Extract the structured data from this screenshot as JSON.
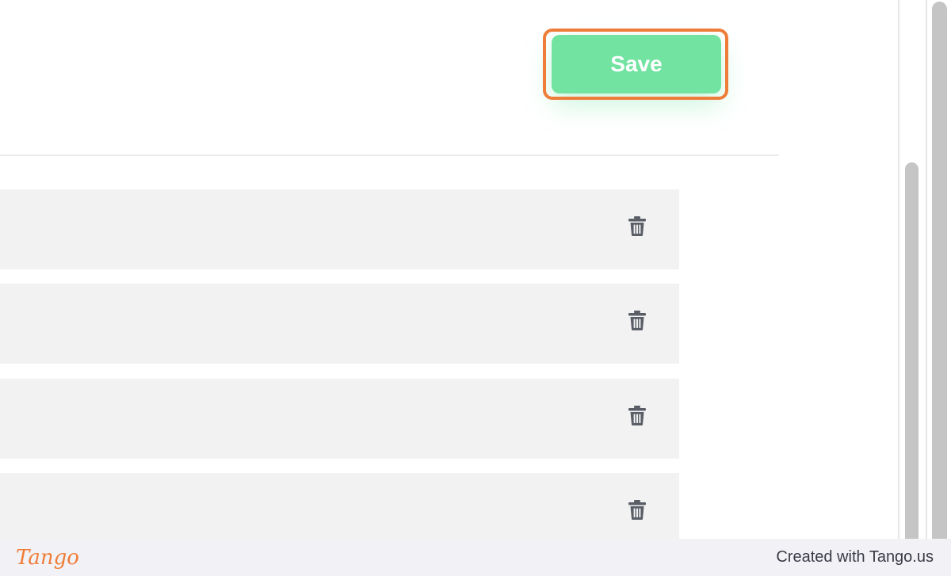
{
  "toolbar": {
    "save_label": "Save"
  },
  "list": {
    "rows": [
      {
        "delete_icon": "trash-icon"
      },
      {
        "delete_icon": "trash-icon"
      },
      {
        "delete_icon": "trash-icon"
      },
      {
        "delete_icon": "trash-icon"
      }
    ]
  },
  "footer": {
    "brand": "Tango",
    "credit": "Created with Tango.us"
  },
  "colors": {
    "save_button": "#72e3a1",
    "highlight": "#ef7d3a",
    "row_background": "#f2f2f2",
    "icon": "#5a5e66",
    "scrollbar_thumb": "#c5c5c5",
    "footer_background": "#f2f2f6"
  }
}
